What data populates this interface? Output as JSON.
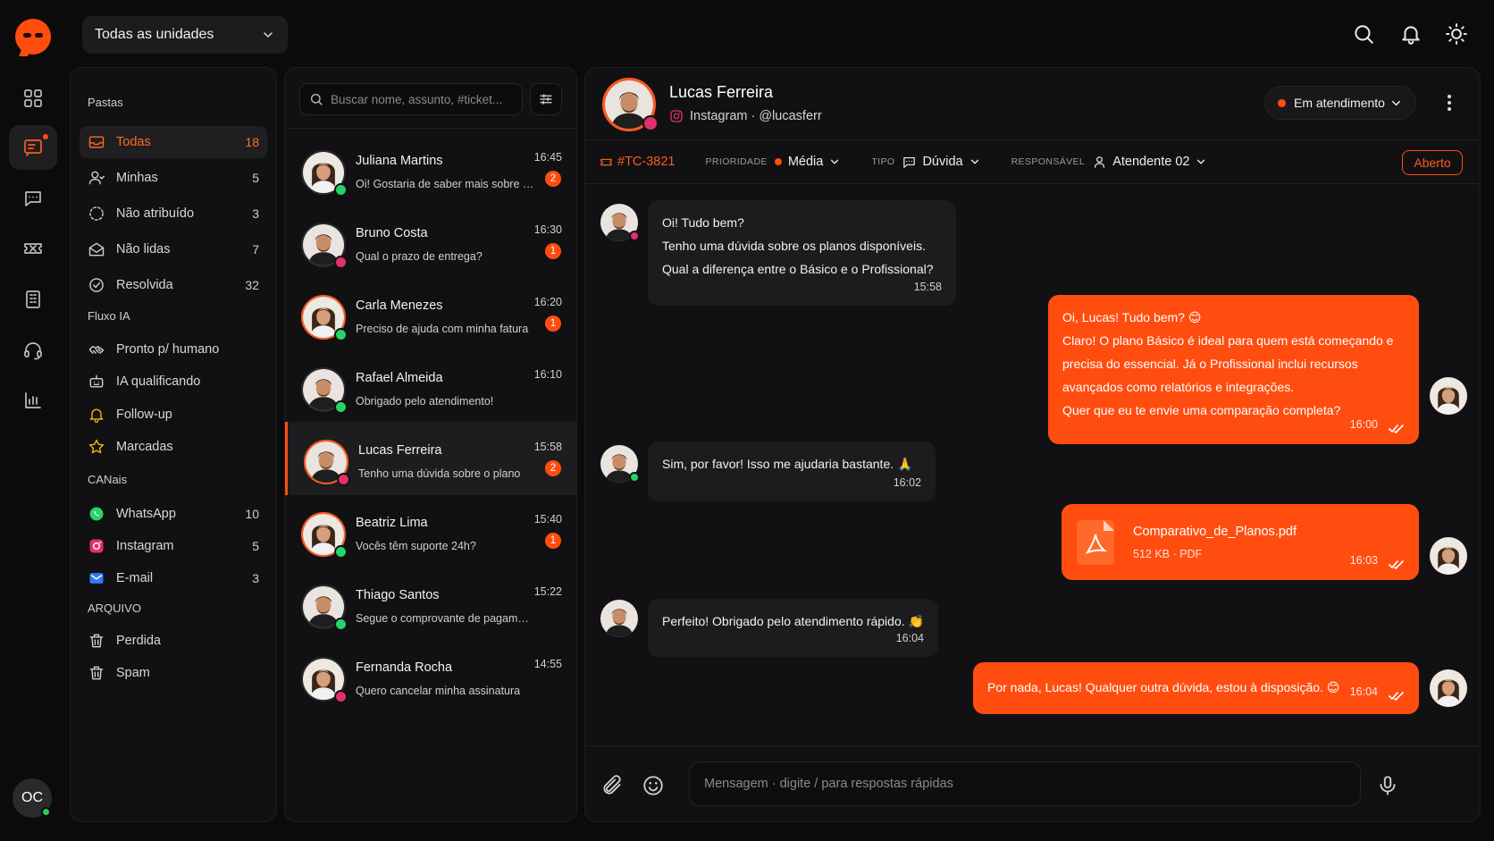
{
  "colors": {
    "accent": "#ff4d10",
    "bg": "#0b0b0c",
    "panel": "#111113",
    "online": "#2ecc5a",
    "whatsapp": "#25d366",
    "instagram": "#e1306c",
    "email": "#2f7bf5"
  },
  "user": {
    "initials": "OC"
  },
  "unit_select": {
    "label": "Todas as unidades"
  },
  "folders": {
    "title": "Pastas",
    "items": [
      {
        "label": "Todas",
        "count": "18",
        "icon": "inbox-icon"
      },
      {
        "label": "Minhas",
        "count": "5",
        "icon": "user-icon"
      },
      {
        "label": "Não atribuído",
        "count": "3",
        "icon": "dashed-circle-icon"
      },
      {
        "label": "Não lidas",
        "count": "7",
        "icon": "envelope-open-icon"
      },
      {
        "label": "Resolvida",
        "count": "32",
        "icon": "check-circle-icon"
      }
    ]
  },
  "flow": {
    "title": "Fluxo IA",
    "items": [
      {
        "label": "Pronto p/ humano",
        "icon": "handshake-icon"
      },
      {
        "label": "IA qualificando",
        "icon": "robot-icon"
      },
      {
        "label": "Follow-up",
        "icon": "bell-icon"
      },
      {
        "label": "Marcadas",
        "icon": "star-icon"
      }
    ]
  },
  "channels": {
    "title": "CANais",
    "items": [
      {
        "label": "WhatsApp",
        "count": "10",
        "icon": "whatsapp-icon"
      },
      {
        "label": "Instagram",
        "count": "5",
        "icon": "instagram-icon"
      },
      {
        "label": "E-mail",
        "count": "3",
        "icon": "email-icon"
      }
    ]
  },
  "archive": {
    "title": "ARQUIVO",
    "items": [
      {
        "label": "Perdida",
        "icon": "trash-icon"
      },
      {
        "label": "Spam",
        "icon": "trash-icon"
      }
    ]
  },
  "search": {
    "placeholder": "Buscar nome, assunto, #ticket..."
  },
  "conversations": [
    {
      "name": "Juliana Martins",
      "snippet": "Oi! Gostaria de saber mais sobre os...",
      "time": "16:45",
      "unread": "2",
      "channel": "whatsapp",
      "avatar": "female"
    },
    {
      "name": "Bruno Costa",
      "snippet": "Qual o prazo de entrega?",
      "time": "16:30",
      "unread": "1",
      "channel": "instagram",
      "avatar": "male"
    },
    {
      "name": "Carla Menezes",
      "snippet": "Preciso de ajuda com minha fatura",
      "time": "16:20",
      "unread": "1",
      "channel": "whatsapp",
      "avatar": "female"
    },
    {
      "name": "Rafael Almeida",
      "snippet": "Obrigado pelo atendimento!",
      "time": "16:10",
      "unread": "",
      "channel": "whatsapp",
      "avatar": "male"
    },
    {
      "name": "Lucas Ferreira",
      "snippet": "Tenho uma dúvida sobre o plano",
      "time": "15:58",
      "unread": "2",
      "channel": "instagram",
      "avatar": "male"
    },
    {
      "name": "Beatriz Lima",
      "snippet": "Vocês têm suporte 24h?",
      "time": "15:40",
      "unread": "1",
      "channel": "whatsapp",
      "avatar": "female"
    },
    {
      "name": "Thiago Santos",
      "snippet": "Segue o comprovante de pagamento",
      "time": "15:22",
      "unread": "",
      "channel": "whatsapp",
      "avatar": "male"
    },
    {
      "name": "Fernanda Rocha",
      "snippet": "Quero cancelar minha assinatura",
      "time": "14:55",
      "unread": "",
      "channel": "instagram",
      "avatar": "female"
    }
  ],
  "chat": {
    "contact_name": "Lucas Ferreira",
    "contact_sub": "Instagram · @lucasferr",
    "status": "Em atendimento",
    "ticket": "#TC-3821",
    "priority_label": "PRIORIDADE",
    "priority_value": "Média",
    "type_label": "TIPO",
    "type_value": "Dúvida",
    "owner_label": "RESPONSÁVEL",
    "owner_value": "Atendente 02",
    "state": "Aberto",
    "messages": [
      {
        "dir": "in",
        "lines": [
          "Oi! Tudo bem?",
          "Tenho uma dúvida sobre os planos disponíveis.",
          "Qual a diferença entre o Básico e o Profissional?"
        ],
        "time": "15:58"
      },
      {
        "dir": "out",
        "lines": [
          "Oi, Lucas! Tudo bem? 😊",
          "Claro! O plano Básico é ideal para quem está começando e",
          "precisa do essencial. Já o Profissional inclui recursos",
          "avançados como relatórios e integrações.",
          "Quer que eu te envie uma comparação completa?"
        ],
        "time": "16:00"
      },
      {
        "dir": "in",
        "lines": [
          "Sim, por favor! Isso me ajudaria bastante. 🙏"
        ],
        "time": "16:02"
      },
      {
        "dir": "out",
        "file_name": "Comparativo_de_Planos.pdf",
        "file_meta": "512 KB · PDF",
        "time": "16:03"
      },
      {
        "dir": "in",
        "lines": [
          "Perfeito! Obrigado pelo atendimento rápido. 👏"
        ],
        "time": "16:04"
      },
      {
        "dir": "out",
        "lines": [
          "Por nada, Lucas! Qualquer outra dúvida, estou à disposição. 😊"
        ],
        "time": "16:04"
      }
    ],
    "composer_placeholder": "Mensagem · digite / para respostas rápidas"
  }
}
